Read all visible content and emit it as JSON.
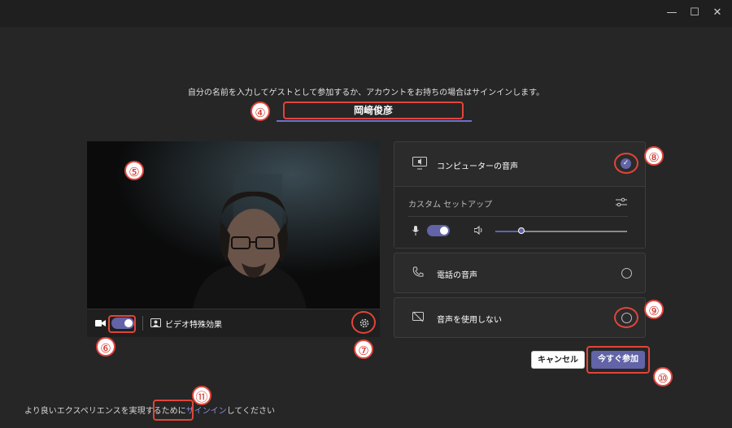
{
  "window": {
    "minimize": "—",
    "maximize": "☐",
    "close": "✕"
  },
  "instruction": "自分の名前を入力してゲストとして参加するか、アカウントをお持ちの場合はサインインします。",
  "name_input": {
    "value": "岡﨑俊彦"
  },
  "video_bar": {
    "effects_label": "ビデオ特殊効果"
  },
  "audio": {
    "computer_label": "コンピューターの音声",
    "custom_setup_label": "カスタム セットアップ",
    "volume_level": 0.2,
    "phone_label": "電話の音声",
    "none_label": "音声を使用しない"
  },
  "buttons": {
    "cancel": "キャンセル",
    "join": "今すぐ参加"
  },
  "footer": {
    "prefix": "より良いエクスペリエンスを実現するために",
    "link": "サインイン",
    "suffix": "してください"
  },
  "annotations": [
    "④",
    "⑤",
    "⑥",
    "⑦",
    "⑧",
    "⑨",
    "⑩",
    "⑪"
  ],
  "colors": {
    "accent": "#6264a7",
    "annotation_red": "#e0453a",
    "background": "#262626"
  }
}
